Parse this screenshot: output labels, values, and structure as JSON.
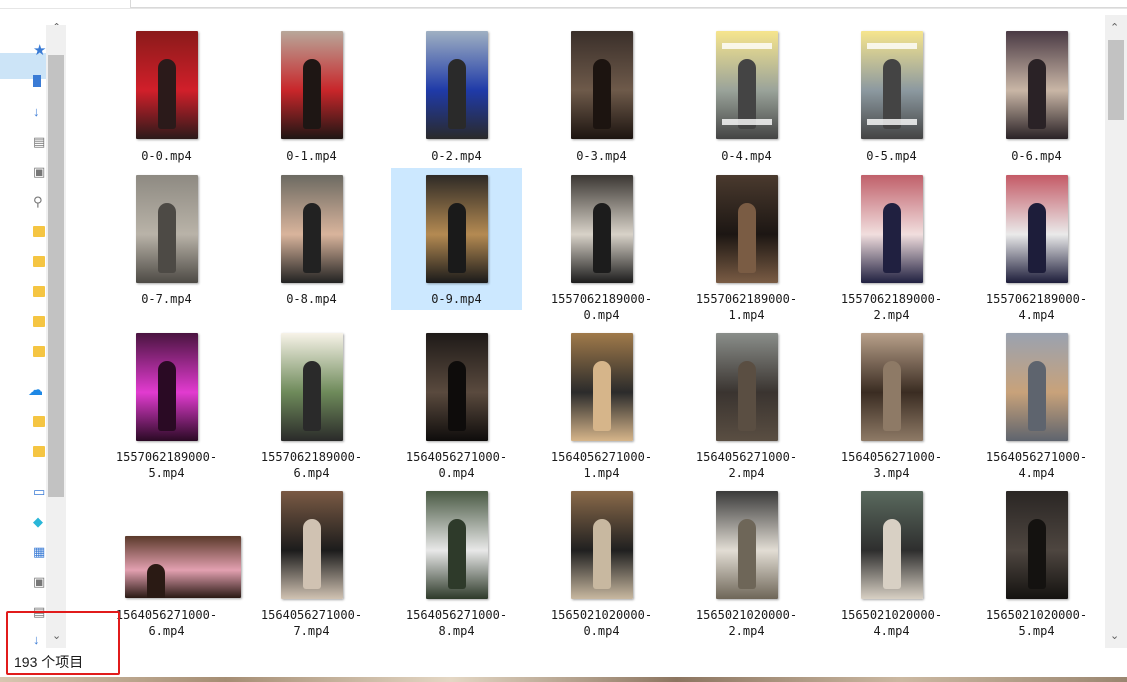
{
  "status": {
    "item_count": "193 个项目"
  },
  "colors": {
    "selection": "#cce8ff",
    "highlight_box": "#e11b1b",
    "folder": "#f5c542"
  },
  "files": [
    {
      "name": "0-0.mp4",
      "thumb": [
        "#8a1a1a",
        "#d11f2a",
        "#2b1a1a"
      ]
    },
    {
      "name": "0-1.mp4",
      "thumb": [
        "#b8a79a",
        "#c8262a",
        "#1e1614"
      ]
    },
    {
      "name": "0-2.mp4",
      "thumb": [
        "#9fb0c2",
        "#1f3aa8",
        "#2a2a2a"
      ]
    },
    {
      "name": "0-3.mp4",
      "thumb": [
        "#3a2f2a",
        "#6e5a4a",
        "#1c1410"
      ]
    },
    {
      "name": "0-4.mp4",
      "thumb": [
        "#f6e58d",
        "#9aa39a",
        "#444444"
      ]
    },
    {
      "name": "0-5.mp4",
      "thumb": [
        "#f6e58d",
        "#8c99a0",
        "#444444"
      ]
    },
    {
      "name": "0-6.mp4",
      "thumb": [
        "#4a3a44",
        "#c9b6a6",
        "#2a2226"
      ]
    },
    {
      "name": "0-7.mp4",
      "thumb": [
        "#8e8a82",
        "#b9b3a8",
        "#4d4a45"
      ]
    },
    {
      "name": "0-8.mp4",
      "thumb": [
        "#6c6a62",
        "#d9b49c",
        "#222222"
      ]
    },
    {
      "name": "0-9.mp4",
      "thumb": [
        "#2e2a26",
        "#b48a52",
        "#1a1a1a"
      ]
    },
    {
      "name": "1557062189000-\n0.mp4",
      "thumb": [
        "#3b3733",
        "#d8d2c8",
        "#1c1c1c"
      ]
    },
    {
      "name": "1557062189000-\n1.mp4",
      "thumb": [
        "#4a3a2e",
        "#1c1613",
        "#7a5c44"
      ]
    },
    {
      "name": "1557062189000-\n2.mp4",
      "thumb": [
        "#c0606a",
        "#f1dede",
        "#202040"
      ]
    },
    {
      "name": "1557062189000-\n4.mp4",
      "thumb": [
        "#c45a66",
        "#eaeaea",
        "#1d1d3a"
      ]
    },
    {
      "name": "1557062189000-\n5.mp4",
      "thumb": [
        "#4a1440",
        "#e23bd0",
        "#2a0a24"
      ]
    },
    {
      "name": "1557062189000-\n6.mp4",
      "thumb": [
        "#f7f3e8",
        "#6e8a5a",
        "#2a2a2a"
      ]
    },
    {
      "name": "1564056271000-\n0.mp4",
      "thumb": [
        "#1e1a18",
        "#5a4a3e",
        "#0e0c0b"
      ]
    },
    {
      "name": "1564056271000-\n1.mp4",
      "thumb": [
        "#a07a4a",
        "#2b2b2b",
        "#d6b58a"
      ]
    },
    {
      "name": "1564056271000-\n2.mp4",
      "thumb": [
        "#8a8e8a",
        "#3a3430",
        "#5a4e42"
      ]
    },
    {
      "name": "1564056271000-\n3.mp4",
      "thumb": [
        "#b8a08a",
        "#3a2c22",
        "#8e7a66"
      ]
    },
    {
      "name": "1564056271000-\n4.mp4",
      "thumb": [
        "#9aa2b0",
        "#c8a27a",
        "#5e646e"
      ]
    },
    {
      "name": "1564056271000-\n6.mp4",
      "thumb": [
        "#5a3a2a",
        "#e2a0b0",
        "#2a1a14"
      ]
    },
    {
      "name": "1564056271000-\n7.mp4",
      "thumb": [
        "#7a5a44",
        "#1c1c1c",
        "#d0c2b2"
      ]
    },
    {
      "name": "1564056271000-\n8.mp4",
      "thumb": [
        "#4a5a44",
        "#e8e8e8",
        "#2e3a2a"
      ]
    },
    {
      "name": "1565021020000-\n0.mp4",
      "thumb": [
        "#8a6a4a",
        "#202020",
        "#c8b8a0"
      ]
    },
    {
      "name": "1565021020000-\n2.mp4",
      "thumb": [
        "#3a3a3a",
        "#e2ddd4",
        "#6e6658"
      ]
    },
    {
      "name": "1565021020000-\n4.mp4",
      "thumb": [
        "#5a6a5e",
        "#2e2e2e",
        "#d8d0c4"
      ]
    },
    {
      "name": "1565021020000-\n5.mp4",
      "thumb": [
        "#2a2624",
        "#4e4640",
        "#141210"
      ]
    }
  ]
}
